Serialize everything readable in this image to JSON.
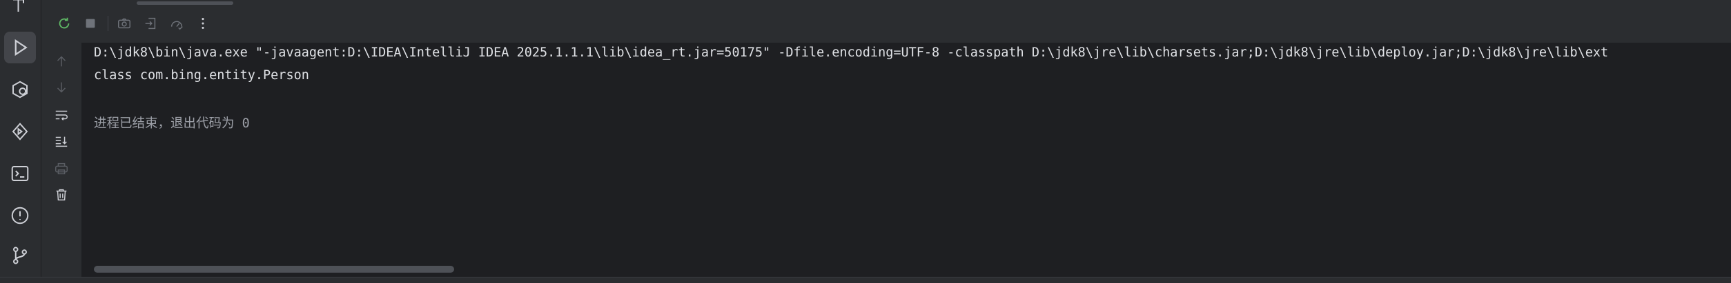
{
  "left_strip": {
    "items": [
      {
        "name": "build-icon"
      },
      {
        "name": "run-icon",
        "active": true
      },
      {
        "name": "services-icon"
      },
      {
        "name": "endpoints-icon"
      },
      {
        "name": "terminal-icon"
      },
      {
        "name": "problems-icon"
      },
      {
        "name": "git-icon"
      }
    ]
  },
  "toolbar": {
    "buttons": [
      "rerun-icon",
      "stop-icon",
      "screenshot-icon",
      "restore-layout-icon",
      "profiler-icon",
      "more-icon"
    ]
  },
  "side_actions": [
    "up-arrow-icon",
    "down-arrow-icon",
    "soft-wrap-icon",
    "scroll-to-end-icon",
    "print-icon",
    "clear-all-icon"
  ],
  "console": {
    "lines": [
      "D:\\jdk8\\bin\\java.exe \"-javaagent:D:\\IDEA\\IntelliJ IDEA 2025.1.1.1\\lib\\idea_rt.jar=50175\" -Dfile.encoding=UTF-8 -classpath D:\\jdk8\\jre\\lib\\charsets.jar;D:\\jdk8\\jre\\lib\\deploy.jar;D:\\jdk8\\jre\\lib\\ext",
      "class com.bing.entity.Person",
      "",
      "进程已结束，退出代码为 0"
    ]
  },
  "colors": {
    "background": "#1e1f22",
    "panel": "#2b2d30",
    "text": "#dfe1e5",
    "muted_text": "#9da0a8",
    "accent_green": "#5fb865"
  }
}
